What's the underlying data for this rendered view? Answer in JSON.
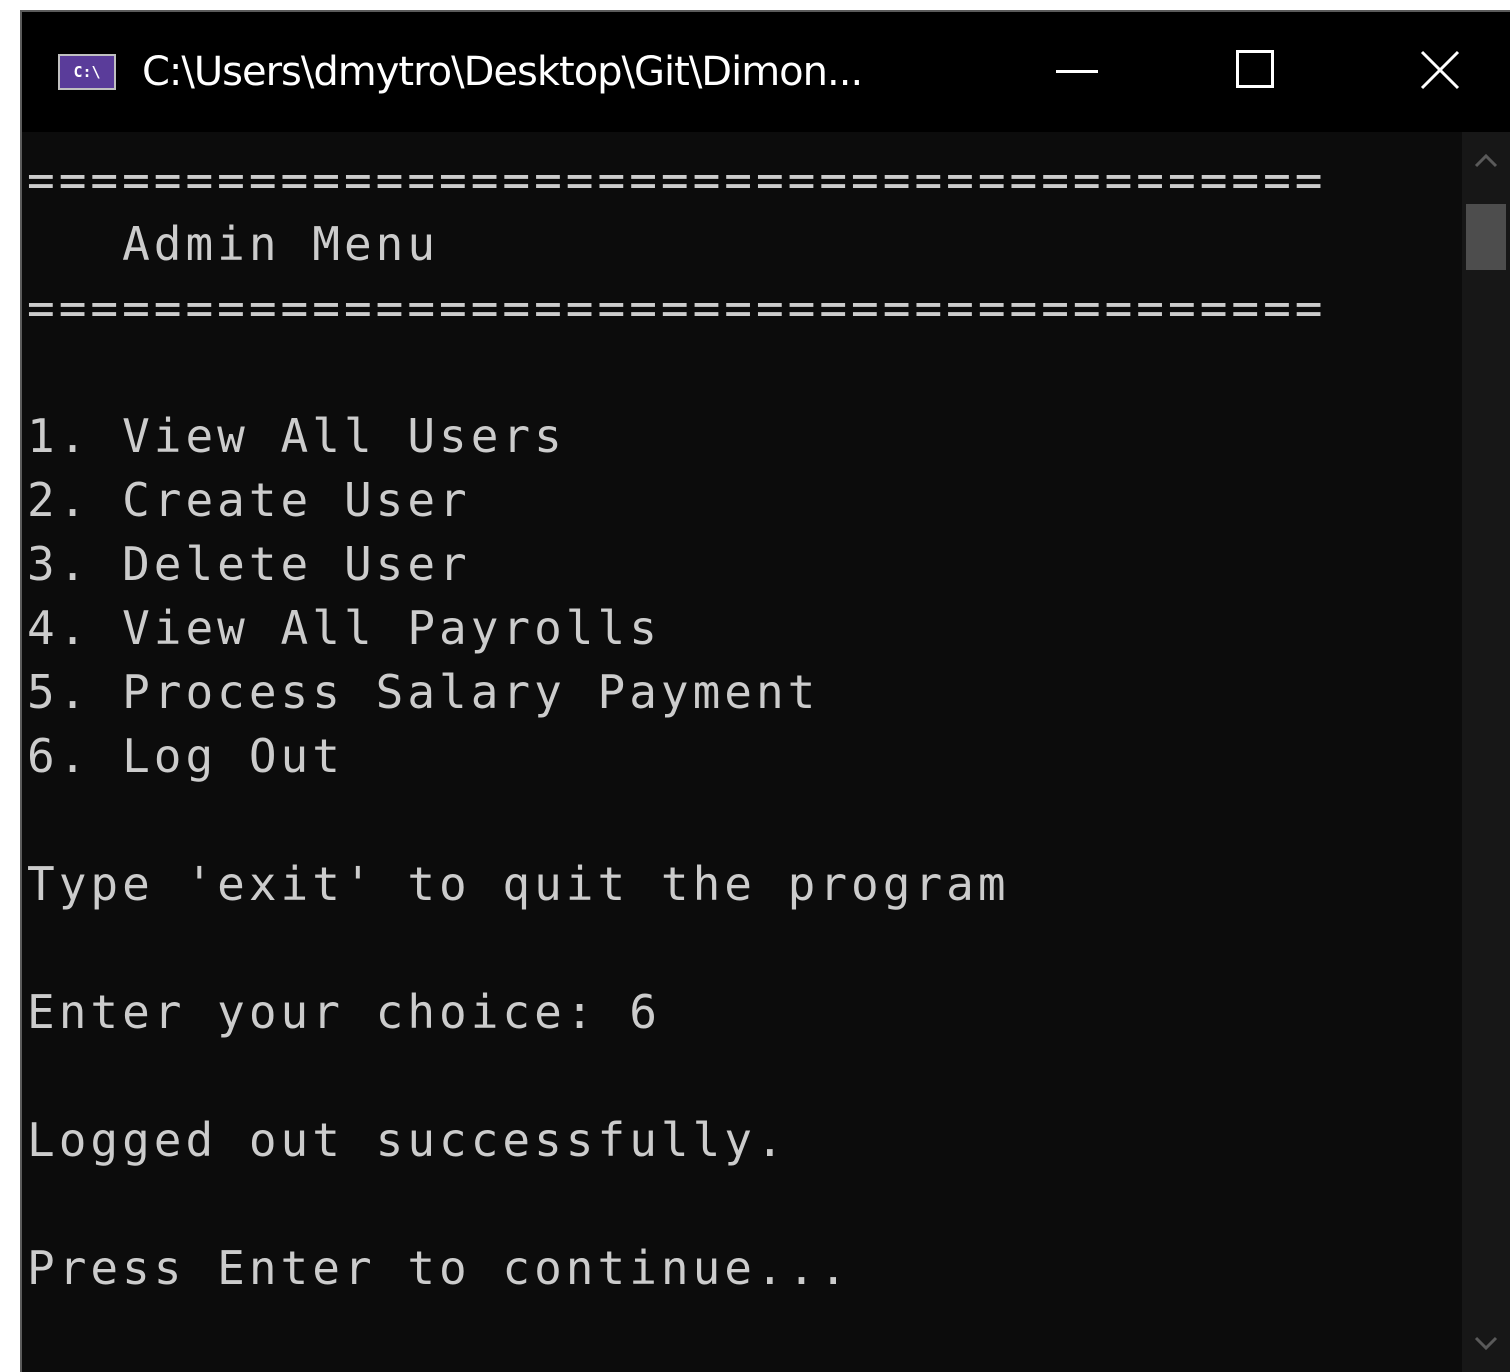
{
  "window": {
    "title": "C:\\Users\\dmytro\\Desktop\\Git\\Dimon...",
    "icon_label": "C:\\",
    "icon_name": "console-icon"
  },
  "controls": {
    "minimize_icon": "minimize-icon",
    "maximize_icon": "maximize-icon",
    "close_icon": "close-icon"
  },
  "console": {
    "separator_top": "=========================================",
    "header": "   Admin Menu",
    "separator_bottom": "=========================================",
    "menu_items": [
      "1. View All Users",
      "2. Create User",
      "3. Delete User",
      "4. View All Payrolls",
      "5. Process Salary Payment",
      "6. Log Out"
    ],
    "exit_hint": "Type 'exit' to quit the program",
    "prompt": "Enter your choice: 6",
    "status": "Logged out successfully.",
    "continue_prompt": "Press Enter to continue..."
  },
  "colors": {
    "console_background": "#0c0c0c",
    "console_text": "#cccccc",
    "titlebar_background": "#000000",
    "icon_accent": "#5a3c9a"
  }
}
